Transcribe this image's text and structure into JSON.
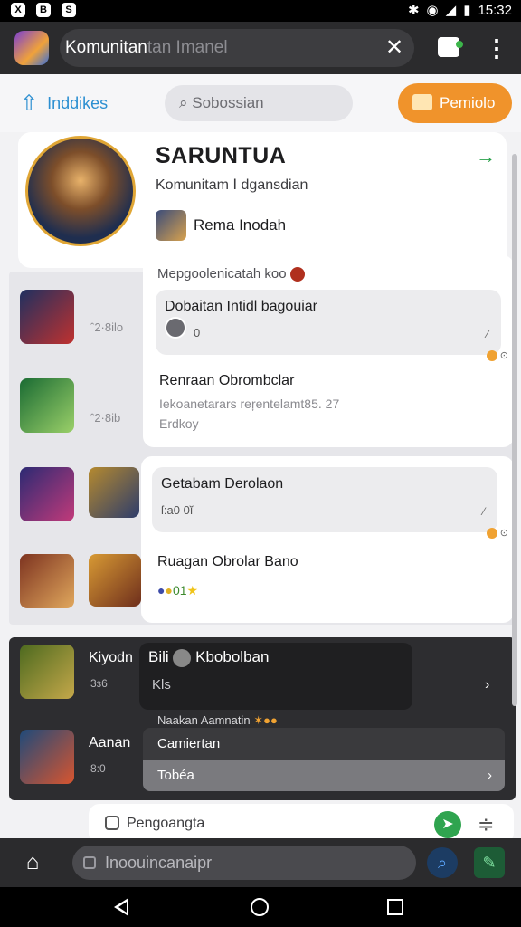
{
  "statusbar": {
    "time": "15:32",
    "left_icons": [
      "X",
      "B",
      "S"
    ]
  },
  "appbar": {
    "title": "Komunitan",
    "title_suffix": "tan Imanel",
    "close": "✕",
    "more": "⋮"
  },
  "toolbar": {
    "left_label": "Inddikes",
    "search_placeholder": "Sobossian",
    "button_label": "Pemiolo"
  },
  "profile": {
    "title": "SARUNTUA",
    "subtitle": "Komunitam Ⅰ dgansdian",
    "user_name": "Rema Inodah"
  },
  "background_list": {
    "meta1": "ˆ2·8ilo",
    "meta2": "ˆ2·8ib",
    "dark_name1": "Kiyodn",
    "dark_meta1": "3з6",
    "dark_name2": "Aanan",
    "dark_meta2": "8:0"
  },
  "panel1": {
    "header": "Mepgoolenicatah koo",
    "bubble_text": "Dobaitan Intidl bagouiar",
    "bubble_count": "0",
    "item_title": "Renraan Obrombclar",
    "item_sub": "Iekoanetarars reŗentelamt85. 27",
    "item_sub2": "Erdkoy"
  },
  "panel2": {
    "bubble_title": "Getabam Derolaon",
    "bubble_sub": "ſ:a0 0ĭ",
    "item_title": "Ruagan Obrolar Bano",
    "item_reactions": "01"
  },
  "dark_panel": {
    "title_prefix": "Bili",
    "title": "Kbobolban",
    "sub": "Kls",
    "section_header": "Naakan Aamnatin",
    "menu_row1": "Camiertan",
    "menu_row2": "Tobéa"
  },
  "compose": {
    "placeholder": "Pengoangta"
  },
  "bottombar": {
    "search_placeholder": "Inoouincanaipr"
  },
  "colors": {
    "accent_orange": "#f0932b",
    "accent_blue": "#2c8fd1",
    "accent_green": "#2aa14b"
  }
}
